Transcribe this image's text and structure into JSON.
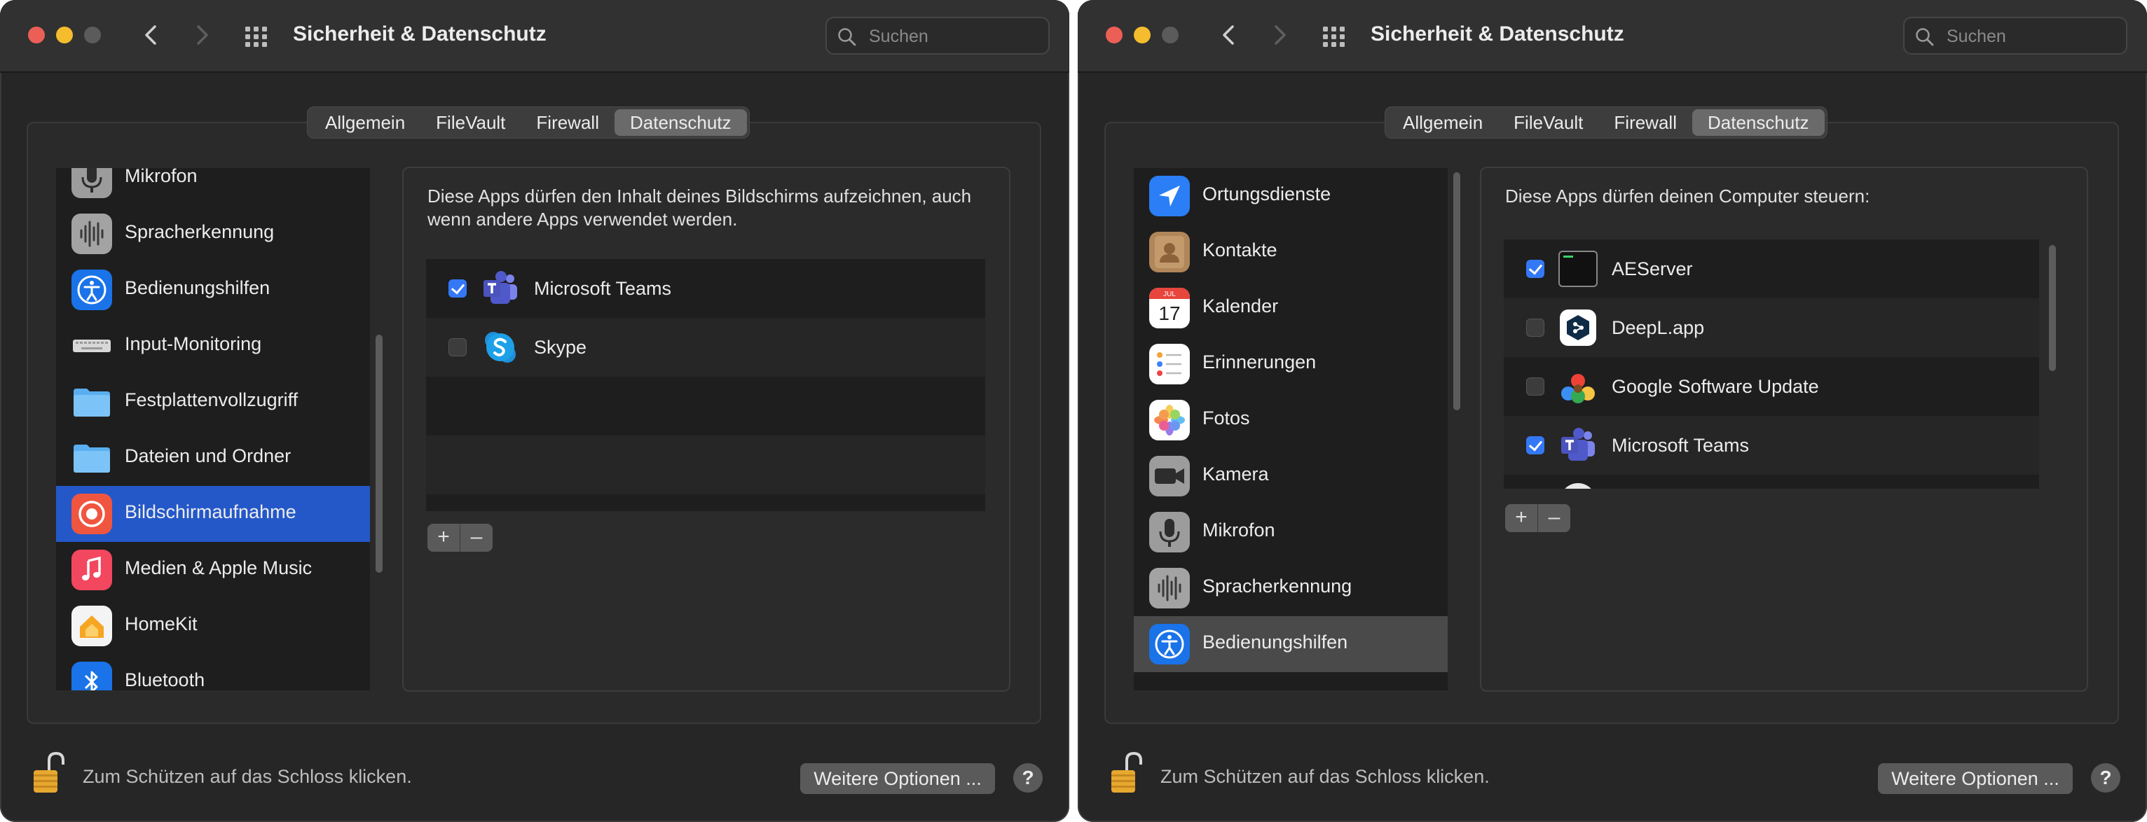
{
  "windows": [
    {
      "title": "Sicherheit & Datenschutz",
      "search_placeholder": "Suchen",
      "tabs": [
        "Allgemein",
        "FileVault",
        "Firewall",
        "Datenschutz"
      ],
      "active_tab": "Datenschutz",
      "sidebar": [
        {
          "label": "Mikrofon",
          "icon": "microphone-icon"
        },
        {
          "label": "Spracherkennung",
          "icon": "waveform-icon"
        },
        {
          "label": "Bedienungshilfen",
          "icon": "accessibility-icon"
        },
        {
          "label": "Input-Monitoring",
          "icon": "keyboard-icon"
        },
        {
          "label": "Festplattenvollzugriff",
          "icon": "folder-icon"
        },
        {
          "label": "Dateien und Ordner",
          "icon": "folder-icon"
        },
        {
          "label": "Bildschirmaufnahme",
          "icon": "screen-recording-icon",
          "selected": true
        },
        {
          "label": "Medien & Apple Music",
          "icon": "music-icon"
        },
        {
          "label": "HomeKit",
          "icon": "home-icon"
        },
        {
          "label": "Bluetooth",
          "icon": "bluetooth-icon"
        }
      ],
      "description": "Diese Apps dürfen den Inhalt deines Bildschirms aufzeichnen, auch wenn andere Apps verwendet werden.",
      "apps": [
        {
          "label": "Microsoft Teams",
          "checked": true,
          "icon": "teams-icon"
        },
        {
          "label": "Skype",
          "checked": false,
          "icon": "skype-icon"
        }
      ],
      "plus_label": "+",
      "minus_label": "–",
      "lock_text": "Zum Schützen auf das Schloss klicken.",
      "more_options": "Weitere Optionen ...",
      "help_label": "?"
    },
    {
      "title": "Sicherheit & Datenschutz",
      "search_placeholder": "Suchen",
      "tabs": [
        "Allgemein",
        "FileVault",
        "Firewall",
        "Datenschutz"
      ],
      "active_tab": "Datenschutz",
      "sidebar": [
        {
          "label": "Ortungsdienste",
          "icon": "location-icon"
        },
        {
          "label": "Kontakte",
          "icon": "contacts-icon"
        },
        {
          "label": "Kalender",
          "icon": "calendar-icon",
          "calendar_month": "JUL",
          "calendar_day": "17"
        },
        {
          "label": "Erinnerungen",
          "icon": "reminders-icon"
        },
        {
          "label": "Fotos",
          "icon": "photos-icon"
        },
        {
          "label": "Kamera",
          "icon": "camera-icon"
        },
        {
          "label": "Mikrofon",
          "icon": "microphone-icon"
        },
        {
          "label": "Spracherkennung",
          "icon": "waveform-icon"
        },
        {
          "label": "Bedienungshilfen",
          "icon": "accessibility-icon",
          "selected": true
        }
      ],
      "description": "Diese Apps dürfen deinen Computer steuern:",
      "apps": [
        {
          "label": "AEServer",
          "checked": true,
          "icon": "terminal-icon"
        },
        {
          "label": "DeepL.app",
          "checked": false,
          "icon": "deepl-icon"
        },
        {
          "label": "Google Software Update",
          "checked": false,
          "icon": "google-update-icon"
        },
        {
          "label": "Microsoft Teams",
          "checked": true,
          "icon": "teams-icon"
        }
      ],
      "plus_label": "+",
      "minus_label": "–",
      "lock_text": "Zum Schützen auf das Schloss klicken.",
      "more_options": "Weitere Optionen ...",
      "help_label": "?"
    }
  ],
  "colors": {
    "selection_blue": "#2458c9",
    "checkbox_blue": "#3478f6",
    "window_bg": "#262626"
  }
}
